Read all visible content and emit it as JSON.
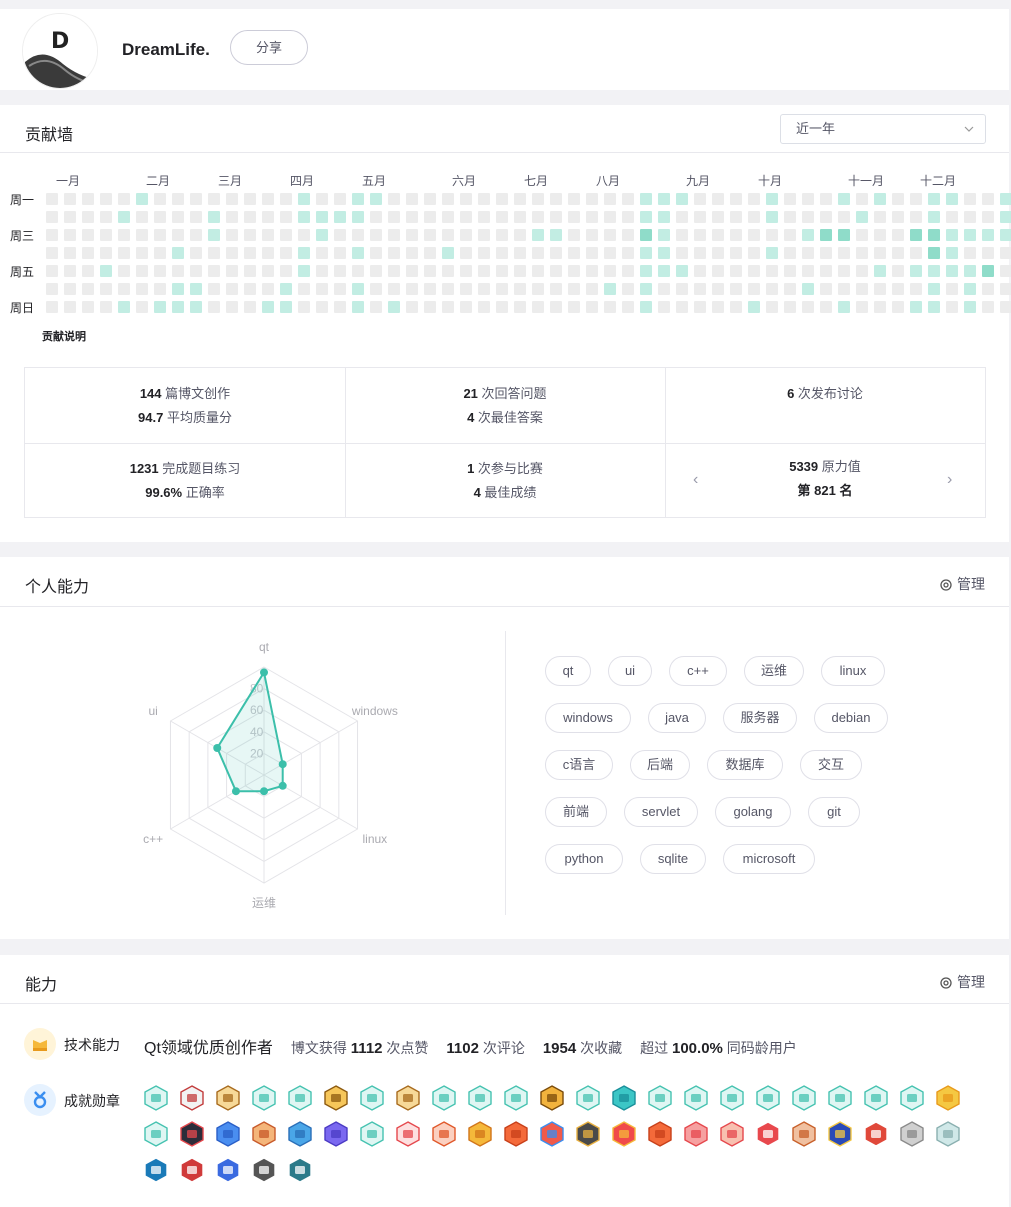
{
  "profile": {
    "name": "DreamLife.",
    "share_label": "分享"
  },
  "contributions": {
    "title": "贡献墙",
    "range": "近一年",
    "months": [
      "一月",
      "二月",
      "三月",
      "四月",
      "五月",
      "六月",
      "七月",
      "八月",
      "九月",
      "十月",
      "十一月",
      "十二月"
    ],
    "weekdays": [
      "周一",
      "周三",
      "周五",
      "周日"
    ],
    "note": "贡献说明",
    "levels": {
      "0,0": 0,
      "0,1": 0,
      "0,2": 0,
      "0,3": 0,
      "0,4": 0,
      "0,5": 1,
      "0,6": 0,
      "0,7": 0,
      "0,8": 0,
      "0,9": 0,
      "0,10": 0,
      "0,11": 0,
      "0,12": 0,
      "0,13": 0,
      "0,14": 1,
      "0,15": 0,
      "0,16": 0,
      "0,17": 1,
      "0,18": 1,
      "0,19": 0,
      "0,20": 0,
      "0,21": 0,
      "0,22": 0,
      "0,23": 0,
      "0,24": 0,
      "0,25": 0,
      "0,26": 0,
      "0,27": 0,
      "0,28": 0,
      "0,29": 0,
      "0,30": 0,
      "0,31": 0,
      "0,32": 0,
      "0,33": 1,
      "0,34": 1,
      "0,35": 1,
      "0,36": 0,
      "0,37": 0,
      "0,38": 0,
      "0,39": 0,
      "0,40": 1,
      "0,41": 0,
      "0,42": 0,
      "0,43": 0,
      "0,44": 1,
      "0,45": 0,
      "0,46": 1,
      "0,47": 0,
      "0,48": 0,
      "0,49": 1,
      "0,50": 1,
      "0,51": 0,
      "0,52": 0,
      "0,53": 1
    },
    "stats": [
      {
        "l1_num": "144",
        "l1_text": "篇博文创作",
        "l2_num": "94.7",
        "l2_text": "平均质量分"
      },
      {
        "l1_num": "21",
        "l1_text": "次回答问题",
        "l2_num": "4",
        "l2_text": "次最佳答案"
      },
      {
        "l1_num": "6",
        "l1_text": "次发布讨论",
        "l2_num": "",
        "l2_text": ""
      },
      {
        "l1_num": "1231",
        "l1_text": "完成题目练习",
        "l2_num": "99.6%",
        "l2_text": "正确率"
      },
      {
        "l1_num": "1",
        "l1_text": "次参与比赛",
        "l2_num": "4",
        "l2_text": "最佳成绩"
      },
      {
        "l1_num": "5339",
        "l1_text": "原力值",
        "l2_num": "第 821 名",
        "l2_text": ""
      }
    ]
  },
  "abilities": {
    "title": "个人能力",
    "manage_label": "管理",
    "radar": {
      "axes": [
        "qt",
        "windows",
        "linux",
        "运维",
        "c++",
        "ui"
      ],
      "ticks": [
        "80",
        "60",
        "40",
        "20"
      ],
      "values": [
        95,
        20,
        20,
        15,
        30,
        50
      ],
      "color": "#3cbfaa"
    },
    "tags": [
      "qt",
      "ui",
      "c++",
      "运维",
      "linux",
      "windows",
      "java",
      "服务器",
      "debian",
      "c语言",
      "后端",
      "数据库",
      "交互",
      "前端",
      "servlet",
      "golang",
      "git",
      "python",
      "sqlite",
      "microsoft"
    ]
  },
  "skills": {
    "title": "能力",
    "manage_label": "管理",
    "tech_label": "技术能力",
    "tech_title": "Qt领域优质创作者",
    "tech_stats": {
      "prefix": "博文获得",
      "likes": "1112",
      "likes_text": "次点赞",
      "comments": "1102",
      "comments_text": "次评论",
      "favorites": "1954",
      "favorites_text": "次收藏",
      "exceed_prefix": "超过",
      "exceed": "100.0%",
      "exceed_text": "同码龄用户"
    },
    "badge_label": "成就勋章",
    "badge_rows": [
      [
        [
          "#dff6f3",
          "#45c2b0"
        ],
        [
          "#f2f2f2",
          "#c23b3b"
        ],
        [
          "#f7d998",
          "#a86b1e"
        ],
        [
          "#dff6f3",
          "#45c2b0"
        ],
        [
          "#dff6f3",
          "#45c2b0"
        ],
        [
          "#f6c65a",
          "#8c5a10"
        ],
        [
          "#dff6f3",
          "#45c2b0"
        ],
        [
          "#f7d998",
          "#a86b1e"
        ],
        [
          "#dff6f3",
          "#45c2b0"
        ],
        [
          "#dff6f3",
          "#45c2b0"
        ],
        [
          "#dff6f3",
          "#45c2b0"
        ],
        [
          "#f2b33d",
          "#7a4b0a"
        ],
        [
          "#dff6f3",
          "#45c2b0"
        ],
        [
          "#3cc6c6",
          "#1a8f9a"
        ],
        [
          "#dff6f3",
          "#45c2b0"
        ],
        [
          "#dff6f3",
          "#45c2b0"
        ],
        [
          "#dff6f3",
          "#45c2b0"
        ],
        [
          "#dff6f3",
          "#45c2b0"
        ],
        [
          "#dff6f3",
          "#45c2b0"
        ],
        [
          "#dff6f3",
          "#45c2b0"
        ],
        [
          "#dff6f3",
          "#45c2b0"
        ],
        [
          "#dff6f3",
          "#45c2b0"
        ],
        [
          "#f5c842",
          "#e89a1c"
        ]
      ],
      [
        [
          "#dff6f3",
          "#45c2b0"
        ],
        [
          "#2d2d3a",
          "#e5484d"
        ],
        [
          "#4a8ef0",
          "#2a5fc7"
        ],
        [
          "#f4b57a",
          "#c85a2a"
        ],
        [
          "#4aa6e8",
          "#2a6fb8"
        ],
        [
          "#7a68f0",
          "#4b3bc4"
        ],
        [
          "#dff6f3",
          "#45c2b0"
        ],
        [
          "#fde0e0",
          "#e5484d"
        ],
        [
          "#fbd0c0",
          "#e0582a"
        ],
        [
          "#f5b83a",
          "#d1751a"
        ],
        [
          "#f46a3a",
          "#c8401a"
        ],
        [
          "#f05a4a",
          "#3a8ef0"
        ],
        [
          "#4a4a4a",
          "#e8b040"
        ],
        [
          "#f04a4a",
          "#f5b83a"
        ],
        [
          "#f46a3a",
          "#c8401a"
        ],
        [
          "#f6a0a0",
          "#e5484d"
        ],
        [
          "#f8c0b0",
          "#e5484d"
        ],
        [
          "#e8484d",
          "#ffffff"
        ],
        [
          "#f0c0a0",
          "#c8602a"
        ],
        [
          "#2a4ab8",
          "#f5c842"
        ],
        [
          "#e0483a",
          "#ffffff"
        ],
        [
          "#d0d0d0",
          "#8a8a8a"
        ],
        [
          "#d0e8e8",
          "#8ab0b0"
        ]
      ],
      [
        [
          "#1a7ab8",
          "#ffffff"
        ],
        [
          "#d03a3a",
          "#ffffff"
        ],
        [
          "#3a6ae0",
          "#ffffff"
        ],
        [
          "#555555",
          "#ffffff"
        ],
        [
          "#2a7a8a",
          "#ffffff"
        ]
      ]
    ]
  }
}
